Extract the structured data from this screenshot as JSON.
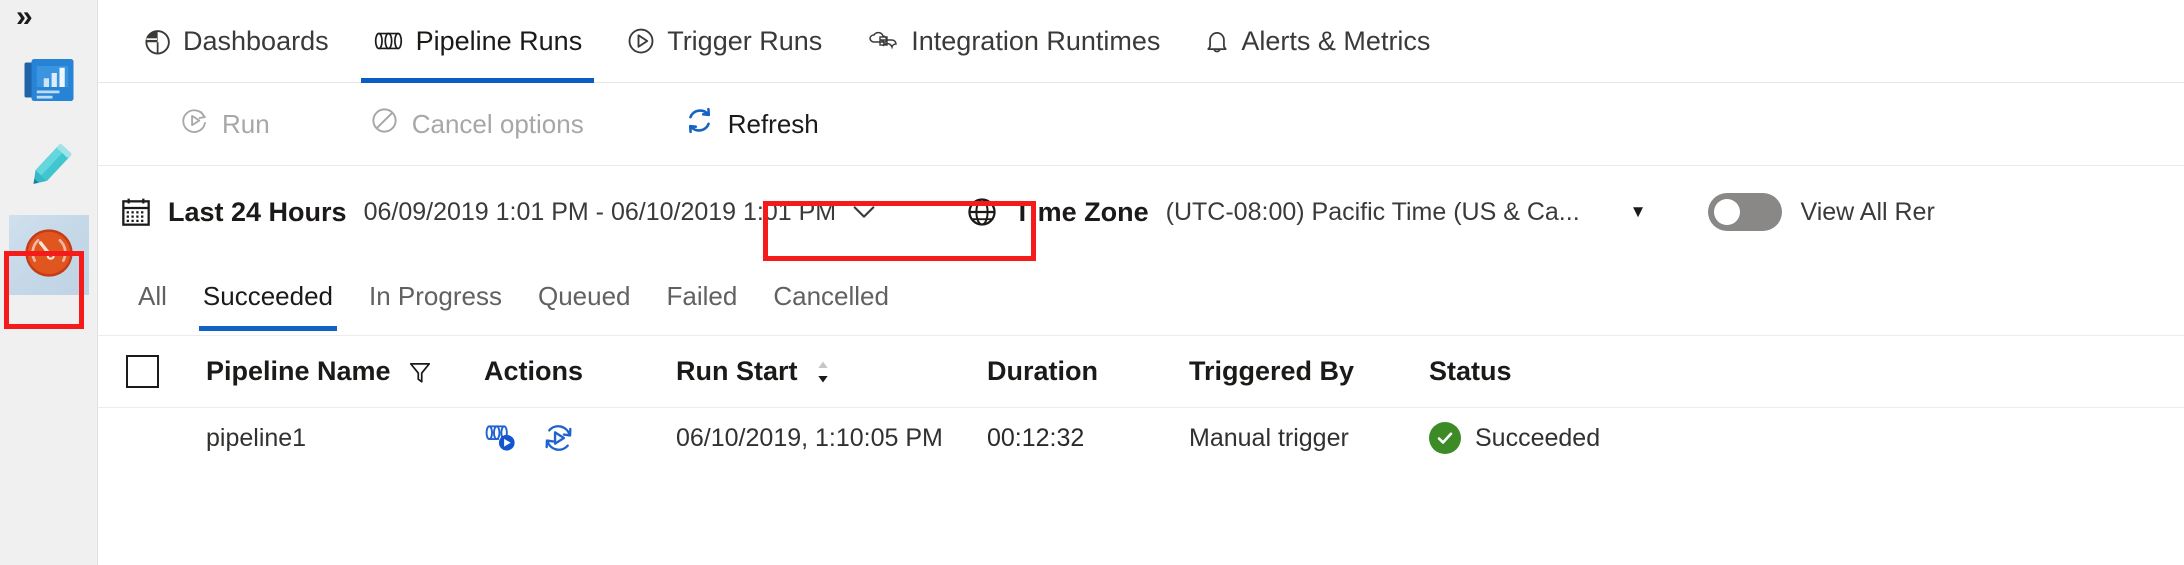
{
  "colors": {
    "accent_blue": "#0b5cc4",
    "highlight_red": "#f61b1b",
    "success_green": "#3d8b27",
    "rail_selected_bg": "#c5d8e8",
    "gauge_icon_red": "#d93f12"
  },
  "rail": {
    "expand_label": "»",
    "items": [
      {
        "name": "monitor-dashboard-icon",
        "selected": false
      },
      {
        "name": "author-pencil-icon",
        "selected": false
      },
      {
        "name": "monitor-gauge-icon",
        "selected": true
      }
    ]
  },
  "tabs": [
    {
      "label": "Dashboards",
      "icon": "pie-chart-icon",
      "active": false
    },
    {
      "label": "Pipeline Runs",
      "icon": "pipeline-icon",
      "active": true
    },
    {
      "label": "Trigger Runs",
      "icon": "play-circle-icon",
      "active": false
    },
    {
      "label": "Integration Runtimes",
      "icon": "integration-runtime-icon",
      "active": false
    },
    {
      "label": "Alerts & Metrics",
      "icon": "bell-icon",
      "active": false
    }
  ],
  "commandbar": {
    "run_label": "Run",
    "run_icon": "run-icon",
    "run_enabled": false,
    "cancel_label": "Cancel options",
    "cancel_icon": "cancel-icon",
    "cancel_enabled": false,
    "refresh_label": "Refresh",
    "refresh_icon": "refresh-icon",
    "refresh_enabled": true,
    "refresh_highlighted": true
  },
  "filterbar": {
    "calendar_icon": "calendar-icon",
    "range_label": "Last 24 Hours",
    "range_value": "06/09/2019 1:01 PM - 06/10/2019 1:01 PM",
    "range_caret": "⌄",
    "globe_icon": "globe-icon",
    "timezone_label": "Time Zone",
    "timezone_value": "(UTC-08:00) Pacific Time (US & Ca...",
    "timezone_caret": "▼",
    "toggle_name": "view-all-reruns-toggle",
    "toggle_on": false,
    "toggle_label": "View All Rer"
  },
  "status_filters": [
    {
      "label": "All",
      "active": false
    },
    {
      "label": "Succeeded",
      "active": true
    },
    {
      "label": "In Progress",
      "active": false
    },
    {
      "label": "Queued",
      "active": false
    },
    {
      "label": "Failed",
      "active": false
    },
    {
      "label": "Cancelled",
      "active": false
    }
  ],
  "table": {
    "columns": {
      "pipeline_name": "Pipeline Name",
      "actions": "Actions",
      "run_start": "Run Start",
      "duration": "Duration",
      "triggered_by": "Triggered By",
      "status": "Status"
    },
    "name_filter_icon": "filter-icon",
    "run_start_sort_icon": "sort-descending-icon",
    "select_all_checkbox": "select-all-checkbox",
    "rows": [
      {
        "pipeline_name": "pipeline1",
        "actions": [
          "view-activity-runs-icon",
          "rerun-icon"
        ],
        "run_start": "06/10/2019, 1:10:05 PM",
        "duration": "00:12:32",
        "triggered_by": "Manual trigger",
        "status": "Succeeded",
        "status_icon": "success-check-icon"
      }
    ]
  }
}
